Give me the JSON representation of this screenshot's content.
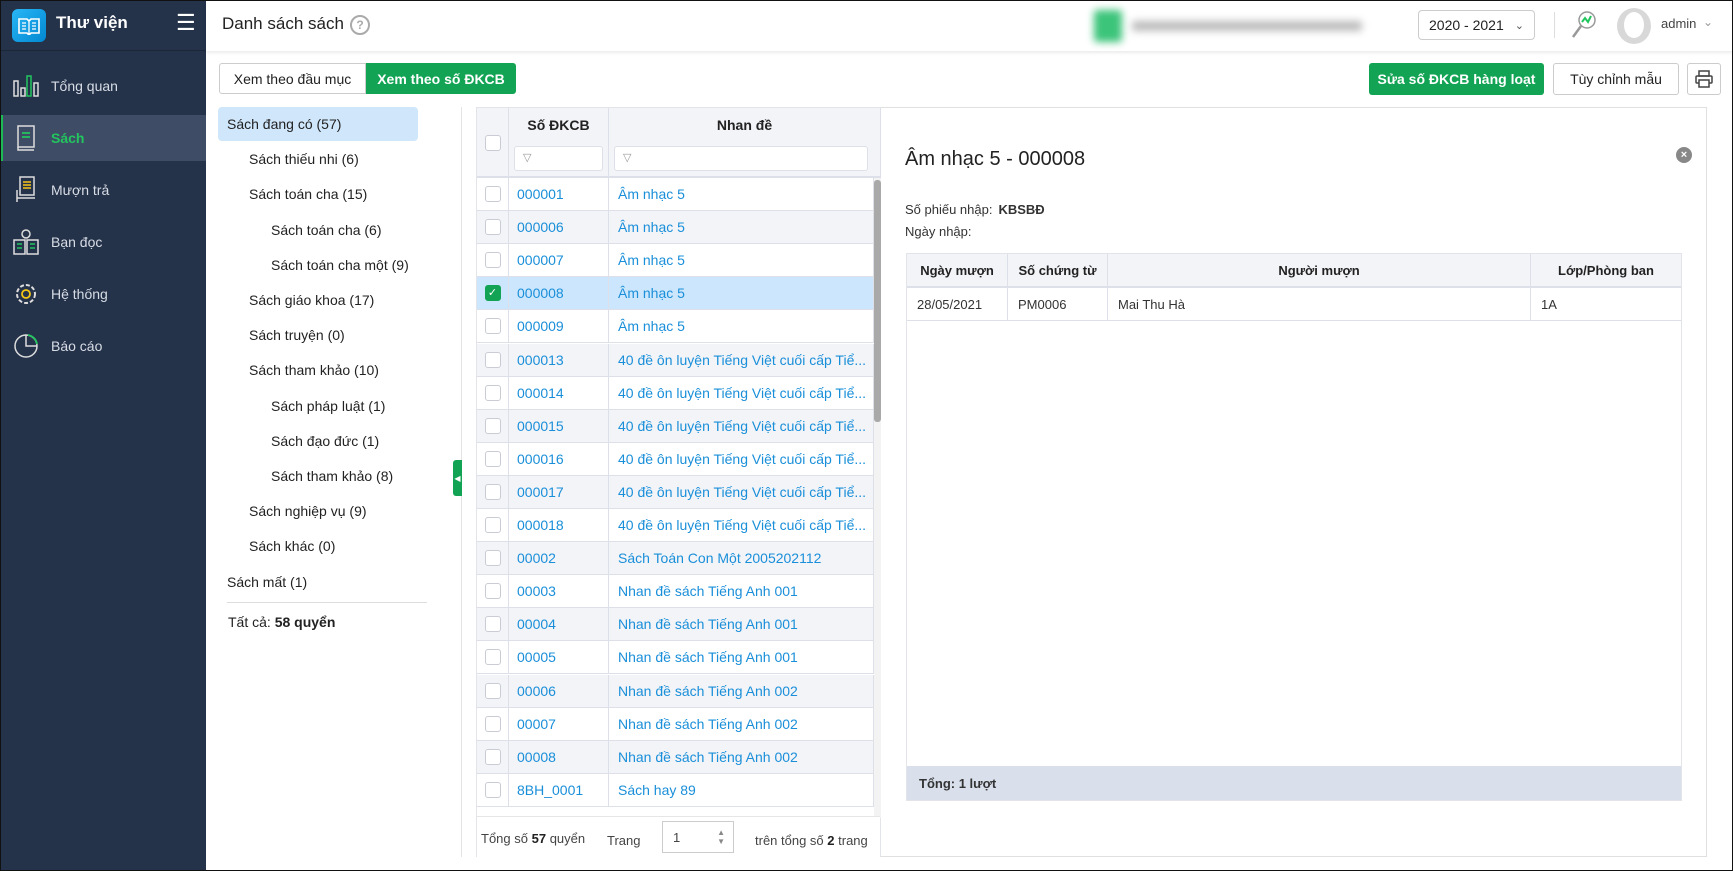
{
  "app": {
    "title": "Thư viện"
  },
  "sidebar": {
    "items": [
      {
        "label": "Tổng quan",
        "icon": "chart-bars-icon"
      },
      {
        "label": "Sách",
        "icon": "book-icon",
        "active": true
      },
      {
        "label": "Mượn trả",
        "icon": "borrow-icon"
      },
      {
        "label": "Bạn đọc",
        "icon": "reader-icon"
      },
      {
        "label": "Hệ thống",
        "icon": "gear-icon"
      },
      {
        "label": "Báo cáo",
        "icon": "pie-chart-icon"
      }
    ]
  },
  "header": {
    "title": "Danh sách sách",
    "help": "?",
    "year": "2020 - 2021",
    "user": "admin"
  },
  "tabs": [
    {
      "label": "Xem theo đầu mục"
    },
    {
      "label": "Xem theo số ĐKCB",
      "active": true
    }
  ],
  "toolbar": {
    "bulk_edit": "Sửa số ĐKCB hàng loạt",
    "customize": "Tùy chỉnh mẫu"
  },
  "tree": {
    "items": [
      {
        "label": "Sách đang có (57)",
        "level": 0,
        "selected": true
      },
      {
        "label": "Sách thiếu nhi (6)",
        "level": 1
      },
      {
        "label": "Sách toán cha (15)",
        "level": 1
      },
      {
        "label": "Sách toán cha (6)",
        "level": 2
      },
      {
        "label": "Sách toán cha một (9)",
        "level": 2
      },
      {
        "label": "Sách giáo khoa (17)",
        "level": 1
      },
      {
        "label": "Sách truyện (0)",
        "level": 1
      },
      {
        "label": "Sách tham khảo (10)",
        "level": 1
      },
      {
        "label": "Sách pháp luật (1)",
        "level": 2
      },
      {
        "label": "Sách đạo đức (1)",
        "level": 2
      },
      {
        "label": "Sách tham khảo (8)",
        "level": 2
      },
      {
        "label": "Sách nghiệp vụ (9)",
        "level": 1
      },
      {
        "label": "Sách khác (0)",
        "level": 1
      },
      {
        "label": "Sách mất (1)",
        "level": 0
      }
    ],
    "total_label": "Tất cả:",
    "total_value": "58 quyển"
  },
  "grid": {
    "columns": [
      "Số ĐKCB",
      "Nhan đề"
    ],
    "rows": [
      {
        "code": "000001",
        "title": "Âm nhạc 5"
      },
      {
        "code": "000006",
        "title": "Âm nhạc 5"
      },
      {
        "code": "000007",
        "title": "Âm nhạc 5"
      },
      {
        "code": "000008",
        "title": "Âm nhạc 5",
        "checked": true
      },
      {
        "code": "000009",
        "title": "Âm nhạc 5"
      },
      {
        "code": "000013",
        "title": "40 đề ôn luyện Tiếng Việt cuối cấp Tiể..."
      },
      {
        "code": "000014",
        "title": "40 đề ôn luyện Tiếng Việt cuối cấp Tiể..."
      },
      {
        "code": "000015",
        "title": "40 đề ôn luyện Tiếng Việt cuối cấp Tiể..."
      },
      {
        "code": "000016",
        "title": "40 đề ôn luyện Tiếng Việt cuối cấp Tiể..."
      },
      {
        "code": "000017",
        "title": "40 đề ôn luyện Tiếng Việt cuối cấp Tiể..."
      },
      {
        "code": "000018",
        "title": "40 đề ôn luyện Tiếng Việt cuối cấp Tiể..."
      },
      {
        "code": "00002",
        "title": "Sách Toán Con Một 2005202112"
      },
      {
        "code": "00003",
        "title": "Nhan đề sách Tiếng Anh 001"
      },
      {
        "code": "00004",
        "title": "Nhan đề sách Tiếng Anh 001"
      },
      {
        "code": "00005",
        "title": "Nhan đề sách Tiếng Anh 001"
      },
      {
        "code": "00006",
        "title": "Nhan đề sách Tiếng Anh 002"
      },
      {
        "code": "00007",
        "title": "Nhan đề sách Tiếng Anh 002"
      },
      {
        "code": "00008",
        "title": "Nhan đề sách Tiếng Anh 002"
      },
      {
        "code": "8BH_0001",
        "title": "Sách hay 89"
      }
    ],
    "footer": {
      "total_prefix": "Tổng số",
      "total_count": "57",
      "total_suffix": "quyển",
      "page_label": "Trang",
      "page": "1",
      "of_prefix": "trên tổng số",
      "pages": "2",
      "of_suffix": "trang"
    }
  },
  "detail": {
    "title": "Âm nhạc 5 - 000008",
    "receipt_label": "Số phiếu nhập:",
    "receipt_value": "KBSBĐ",
    "date_label": "Ngày nhập:",
    "columns": [
      "Ngày mượn",
      "Số chứng từ",
      "Người mượn",
      "Lớp/Phòng ban"
    ],
    "rows": [
      [
        "28/05/2021",
        "PM0006",
        "Mai Thu Hà",
        "1A"
      ]
    ],
    "footer": "Tổng: 1 lượt"
  }
}
